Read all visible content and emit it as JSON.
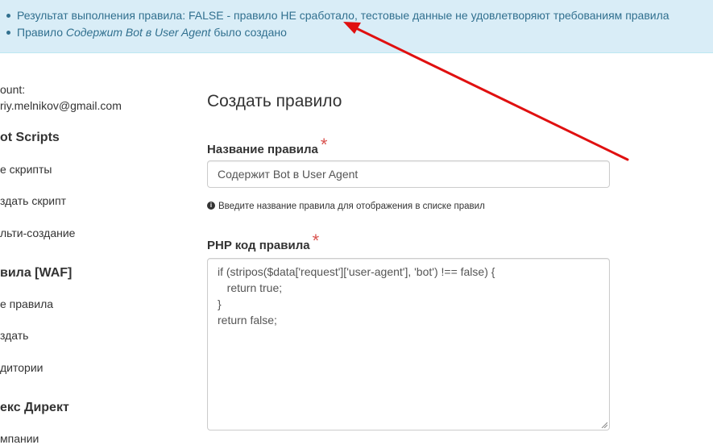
{
  "alert": {
    "line1": "Результат выполнения правила: FALSE - правило НЕ сработало, тестовые данные не удовлетворяют требованиям правила",
    "line2_prefix": "Правило ",
    "line2_name": "Содержит Bot в User Agent",
    "line2_suffix": " было создано"
  },
  "sidebar": {
    "account_label": "ount:",
    "account_email": "riy.melnikov@gmail.com",
    "section1_title": "ot Scripts",
    "section1_items": [
      "е скрипты",
      "здать скрипт",
      "льти-создание"
    ],
    "section2_title": "вила [WAF]",
    "section2_items": [
      "е правила",
      "здать",
      "дитории"
    ],
    "section3_title": "екс Директ",
    "section3_items": [
      "мпании"
    ]
  },
  "form": {
    "title": "Создать правило",
    "name_label": "Название правила",
    "required_mark": "*",
    "name_value": "Содержит Bot в User Agent",
    "name_help": "Введите название правила для отображения в списке правил",
    "code_label": "PHP код правила",
    "code_lines": [
      "if (stripos($data['request']['user-agent'], 'bot') !== false) {",
      "   return true;",
      "}",
      "return false;"
    ]
  },
  "colors": {
    "alert_bg": "#d9edf7",
    "alert_text": "#31708f",
    "required": "#d9534f",
    "annotation_arrow": "#e01010"
  },
  "icons": {
    "help": "info-circle-icon"
  }
}
